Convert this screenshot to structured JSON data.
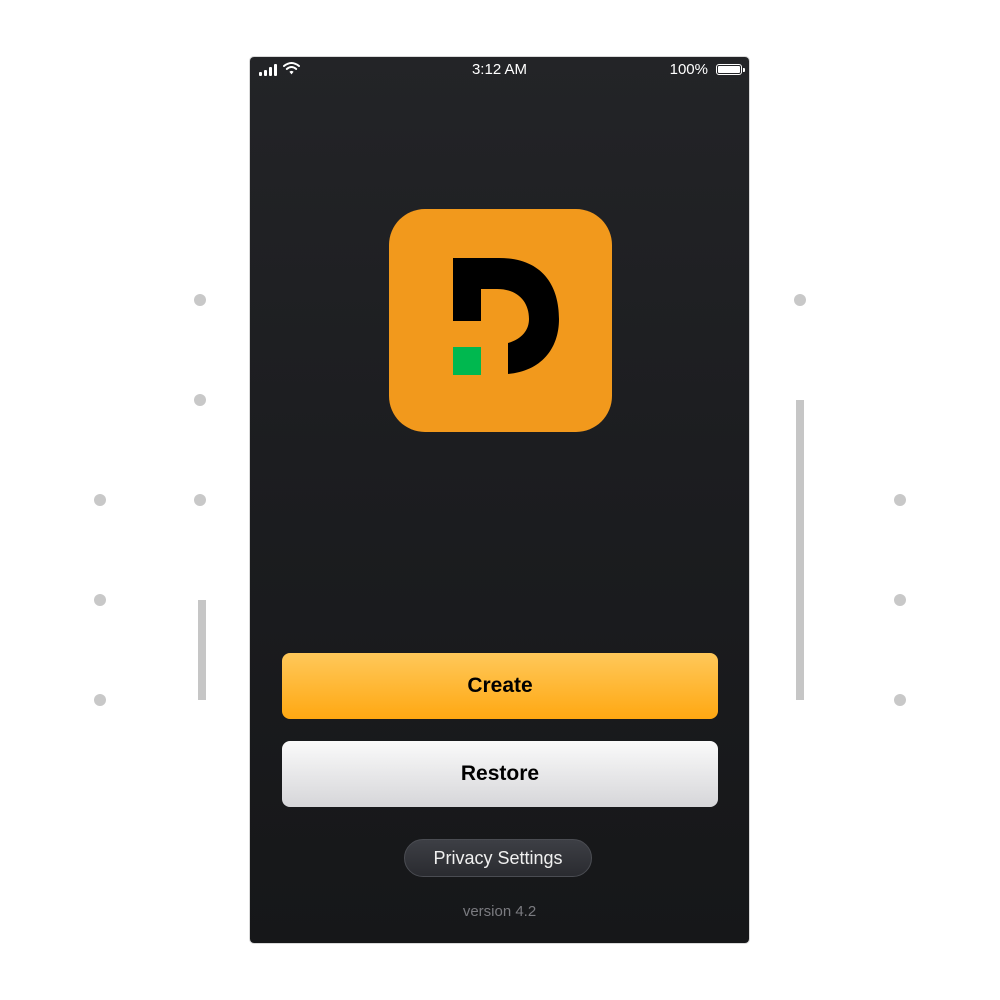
{
  "status_bar": {
    "time": "3:12 AM",
    "battery_percent": "100%",
    "battery_level": 1.0,
    "signal_bars": 4,
    "wifi": true
  },
  "logo": {
    "name": "app-logo-icon",
    "background": "#f2991c",
    "glyph_color": "#000000",
    "square_color": "#00b84f"
  },
  "buttons": {
    "create_label": "Create",
    "restore_label": "Restore",
    "privacy_label": "Privacy Settings"
  },
  "footer": {
    "version": "version 4.2"
  },
  "colors": {
    "phone_bg": "#1c1d20",
    "create_top": "#ffc85a",
    "create_bottom": "#ffa812",
    "restore_top": "#fafafa",
    "restore_bottom": "#d6d6d9",
    "decoration": "#c8c8c8"
  }
}
